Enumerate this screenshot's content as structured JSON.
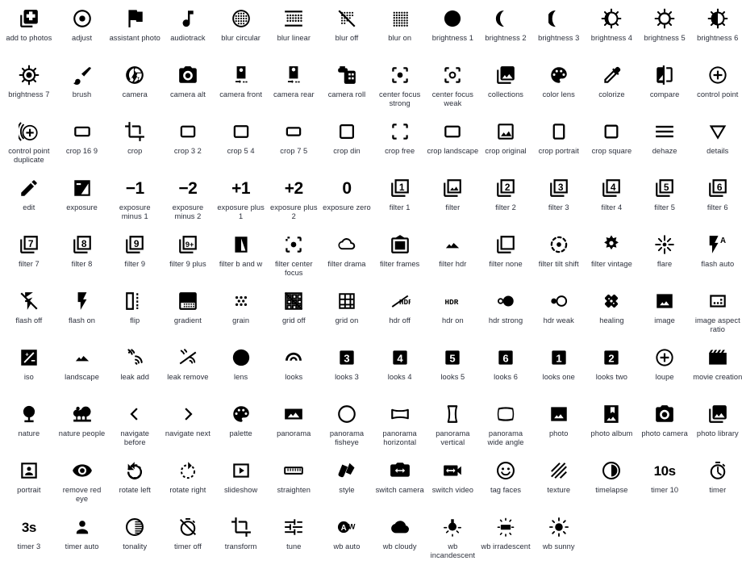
{
  "page": {
    "title": "Photo editing icon gallery",
    "background_color": "#ffffff",
    "icon_color": "#000000",
    "label_color": "#2b2f3b",
    "columns": 14,
    "rows": 11,
    "icon_count": 150
  },
  "icons": [
    {
      "label": "add to photos",
      "icon": "add-to-photos-icon"
    },
    {
      "label": "adjust",
      "icon": "adjust-icon"
    },
    {
      "label": "assistant photo",
      "icon": "assistant-photo-icon"
    },
    {
      "label": "audiotrack",
      "icon": "audiotrack-icon"
    },
    {
      "label": "blur circular",
      "icon": "blur-circular-icon"
    },
    {
      "label": "blur linear",
      "icon": "blur-linear-icon"
    },
    {
      "label": "blur off",
      "icon": "blur-off-icon"
    },
    {
      "label": "blur on",
      "icon": "blur-on-icon"
    },
    {
      "label": "brightness 1",
      "icon": "brightness-1-icon"
    },
    {
      "label": "brightness 2",
      "icon": "brightness-2-icon"
    },
    {
      "label": "brightness 3",
      "icon": "brightness-3-icon"
    },
    {
      "label": "brightness 4",
      "icon": "brightness-4-icon"
    },
    {
      "label": "brightness 5",
      "icon": "brightness-5-icon"
    },
    {
      "label": "brightness 6",
      "icon": "brightness-6-icon"
    },
    {
      "label": "brightness 7",
      "icon": "brightness-7-icon"
    },
    {
      "label": "brush",
      "icon": "brush-icon"
    },
    {
      "label": "camera",
      "icon": "camera-icon"
    },
    {
      "label": "camera alt",
      "icon": "camera-alt-icon"
    },
    {
      "label": "camera front",
      "icon": "camera-front-icon"
    },
    {
      "label": "camera rear",
      "icon": "camera-rear-icon"
    },
    {
      "label": "camera roll",
      "icon": "camera-roll-icon"
    },
    {
      "label": "center focus strong",
      "icon": "center-focus-strong-icon"
    },
    {
      "label": "center focus weak",
      "icon": "center-focus-weak-icon"
    },
    {
      "label": "collections",
      "icon": "collections-icon"
    },
    {
      "label": "color lens",
      "icon": "color-lens-icon"
    },
    {
      "label": "colorize",
      "icon": "colorize-icon"
    },
    {
      "label": "compare",
      "icon": "compare-icon"
    },
    {
      "label": "control point",
      "icon": "control-point-icon"
    },
    {
      "label": "control point duplicate",
      "icon": "control-point-duplicate-icon"
    },
    {
      "label": "crop 16 9",
      "icon": "crop-16-9-icon"
    },
    {
      "label": "crop",
      "icon": "crop-icon"
    },
    {
      "label": "crop 3 2",
      "icon": "crop-3-2-icon"
    },
    {
      "label": "crop 5 4",
      "icon": "crop-5-4-icon"
    },
    {
      "label": "crop 7 5",
      "icon": "crop-7-5-icon"
    },
    {
      "label": "crop din",
      "icon": "crop-din-icon"
    },
    {
      "label": "crop free",
      "icon": "crop-free-icon"
    },
    {
      "label": "crop landscape",
      "icon": "crop-landscape-icon"
    },
    {
      "label": "crop original",
      "icon": "crop-original-icon"
    },
    {
      "label": "crop portrait",
      "icon": "crop-portrait-icon"
    },
    {
      "label": "crop square",
      "icon": "crop-square-icon"
    },
    {
      "label": "dehaze",
      "icon": "dehaze-icon"
    },
    {
      "label": "details",
      "icon": "details-icon"
    },
    {
      "label": "edit",
      "icon": "edit-icon"
    },
    {
      "label": "exposure",
      "icon": "exposure-icon"
    },
    {
      "label": "exposure minus 1",
      "icon": "exposure-minus-1-icon"
    },
    {
      "label": "exposure minus 2",
      "icon": "exposure-minus-2-icon"
    },
    {
      "label": "exposure plus 1",
      "icon": "exposure-plus-1-icon"
    },
    {
      "label": "exposure plus 2",
      "icon": "exposure-plus-2-icon"
    },
    {
      "label": "exposure zero",
      "icon": "exposure-zero-icon"
    },
    {
      "label": "filter 1",
      "icon": "filter-1-icon"
    },
    {
      "label": "filter",
      "icon": "filter-icon"
    },
    {
      "label": "filter 2",
      "icon": "filter-2-icon"
    },
    {
      "label": "filter 3",
      "icon": "filter-3-icon"
    },
    {
      "label": "filter 4",
      "icon": "filter-4-icon"
    },
    {
      "label": "filter 5",
      "icon": "filter-5-icon"
    },
    {
      "label": "filter 6",
      "icon": "filter-6-icon"
    },
    {
      "label": "filter 7",
      "icon": "filter-7-icon"
    },
    {
      "label": "filter 8",
      "icon": "filter-8-icon"
    },
    {
      "label": "filter 9",
      "icon": "filter-9-icon"
    },
    {
      "label": "filter 9 plus",
      "icon": "filter-9-plus-icon"
    },
    {
      "label": "filter b and w",
      "icon": "filter-b-and-w-icon"
    },
    {
      "label": "filter center focus",
      "icon": "filter-center-focus-icon"
    },
    {
      "label": "filter drama",
      "icon": "filter-drama-icon"
    },
    {
      "label": "filter frames",
      "icon": "filter-frames-icon"
    },
    {
      "label": "filter hdr",
      "icon": "filter-hdr-icon"
    },
    {
      "label": "filter none",
      "icon": "filter-none-icon"
    },
    {
      "label": "filter tilt shift",
      "icon": "filter-tilt-shift-icon"
    },
    {
      "label": "filter vintage",
      "icon": "filter-vintage-icon"
    },
    {
      "label": "flare",
      "icon": "flare-icon"
    },
    {
      "label": "flash auto",
      "icon": "flash-auto-icon"
    },
    {
      "label": "flash off",
      "icon": "flash-off-icon"
    },
    {
      "label": "flash on",
      "icon": "flash-on-icon"
    },
    {
      "label": "flip",
      "icon": "flip-icon"
    },
    {
      "label": "gradient",
      "icon": "gradient-icon"
    },
    {
      "label": "grain",
      "icon": "grain-icon"
    },
    {
      "label": "grid off",
      "icon": "grid-off-icon"
    },
    {
      "label": "grid on",
      "icon": "grid-on-icon"
    },
    {
      "label": "hdr off",
      "icon": "hdr-off-icon"
    },
    {
      "label": "hdr on",
      "icon": "hdr-on-icon"
    },
    {
      "label": "hdr strong",
      "icon": "hdr-strong-icon"
    },
    {
      "label": "hdr weak",
      "icon": "hdr-weak-icon"
    },
    {
      "label": "healing",
      "icon": "healing-icon"
    },
    {
      "label": "image",
      "icon": "image-icon"
    },
    {
      "label": "image aspect ratio",
      "icon": "image-aspect-ratio-icon"
    },
    {
      "label": "iso",
      "icon": "iso-icon"
    },
    {
      "label": "landscape",
      "icon": "landscape-icon"
    },
    {
      "label": "leak add",
      "icon": "leak-add-icon"
    },
    {
      "label": "leak remove",
      "icon": "leak-remove-icon"
    },
    {
      "label": "lens",
      "icon": "lens-icon"
    },
    {
      "label": "looks",
      "icon": "looks-icon"
    },
    {
      "label": "looks 3",
      "icon": "looks-3-icon"
    },
    {
      "label": "looks 4",
      "icon": "looks-4-icon"
    },
    {
      "label": "looks 5",
      "icon": "looks-5-icon"
    },
    {
      "label": "looks 6",
      "icon": "looks-6-icon"
    },
    {
      "label": "looks one",
      "icon": "looks-one-icon"
    },
    {
      "label": "looks two",
      "icon": "looks-two-icon"
    },
    {
      "label": "loupe",
      "icon": "loupe-icon"
    },
    {
      "label": "movie creation",
      "icon": "movie-creation-icon"
    },
    {
      "label": "nature",
      "icon": "nature-icon"
    },
    {
      "label": "nature people",
      "icon": "nature-people-icon"
    },
    {
      "label": "navigate before",
      "icon": "navigate-before-icon"
    },
    {
      "label": "navigate next",
      "icon": "navigate-next-icon"
    },
    {
      "label": "palette",
      "icon": "palette-icon"
    },
    {
      "label": "panorama",
      "icon": "panorama-icon"
    },
    {
      "label": "panorama fisheye",
      "icon": "panorama-fisheye-icon"
    },
    {
      "label": "panorama horizontal",
      "icon": "panorama-horizontal-icon"
    },
    {
      "label": "panorama vertical",
      "icon": "panorama-vertical-icon"
    },
    {
      "label": "panorama wide angle",
      "icon": "panorama-wide-angle-icon"
    },
    {
      "label": "photo",
      "icon": "photo-icon"
    },
    {
      "label": "photo album",
      "icon": "photo-album-icon"
    },
    {
      "label": "photo camera",
      "icon": "photo-camera-icon"
    },
    {
      "label": "photo library",
      "icon": "photo-library-icon"
    },
    {
      "label": "portrait",
      "icon": "portrait-icon"
    },
    {
      "label": "remove red eye",
      "icon": "remove-red-eye-icon"
    },
    {
      "label": "rotate left",
      "icon": "rotate-left-icon"
    },
    {
      "label": "rotate right",
      "icon": "rotate-right-icon"
    },
    {
      "label": "slideshow",
      "icon": "slideshow-icon"
    },
    {
      "label": "straighten",
      "icon": "straighten-icon"
    },
    {
      "label": "style",
      "icon": "style-icon"
    },
    {
      "label": "switch camera",
      "icon": "switch-camera-icon"
    },
    {
      "label": "switch video",
      "icon": "switch-video-icon"
    },
    {
      "label": "tag faces",
      "icon": "tag-faces-icon"
    },
    {
      "label": "texture",
      "icon": "texture-icon"
    },
    {
      "label": "timelapse",
      "icon": "timelapse-icon"
    },
    {
      "label": "timer 10",
      "icon": "timer-10-icon"
    },
    {
      "label": "timer",
      "icon": "timer-icon"
    },
    {
      "label": "timer 3",
      "icon": "timer-3-icon"
    },
    {
      "label": "timer auto",
      "icon": "timer-auto-icon"
    },
    {
      "label": "tonality",
      "icon": "tonality-icon"
    },
    {
      "label": "timer off",
      "icon": "timer-off-icon"
    },
    {
      "label": "transform",
      "icon": "transform-icon"
    },
    {
      "label": "tune",
      "icon": "tune-icon"
    },
    {
      "label": "wb auto",
      "icon": "wb-auto-icon"
    },
    {
      "label": "wb cloudy",
      "icon": "wb-cloudy-icon"
    },
    {
      "label": "wb incandescent",
      "icon": "wb-incandescent-icon"
    },
    {
      "label": "wb irradescent",
      "icon": "wb-irradescent-icon"
    },
    {
      "label": "wb sunny",
      "icon": "wb-sunny-icon"
    }
  ],
  "glyph_text": {
    "exposure_minus_1": "−1",
    "exposure_minus_2": "−2",
    "exposure_plus_1": "+1",
    "exposure_plus_2": "+2",
    "exposure_zero": "0",
    "hdr": "HDR",
    "timer_10": "10s",
    "timer_3": "3s",
    "filter_1": "1",
    "filter_2": "2",
    "filter_3": "3",
    "filter_4": "4",
    "filter_5": "5",
    "filter_6": "6",
    "filter_7": "7",
    "filter_8": "8",
    "filter_9": "9",
    "filter_9_plus": "9+",
    "looks_1": "1",
    "looks_2": "2",
    "looks_3": "3",
    "looks_4": "4",
    "looks_5": "5",
    "looks_6": "6",
    "wb_auto": "A"
  }
}
